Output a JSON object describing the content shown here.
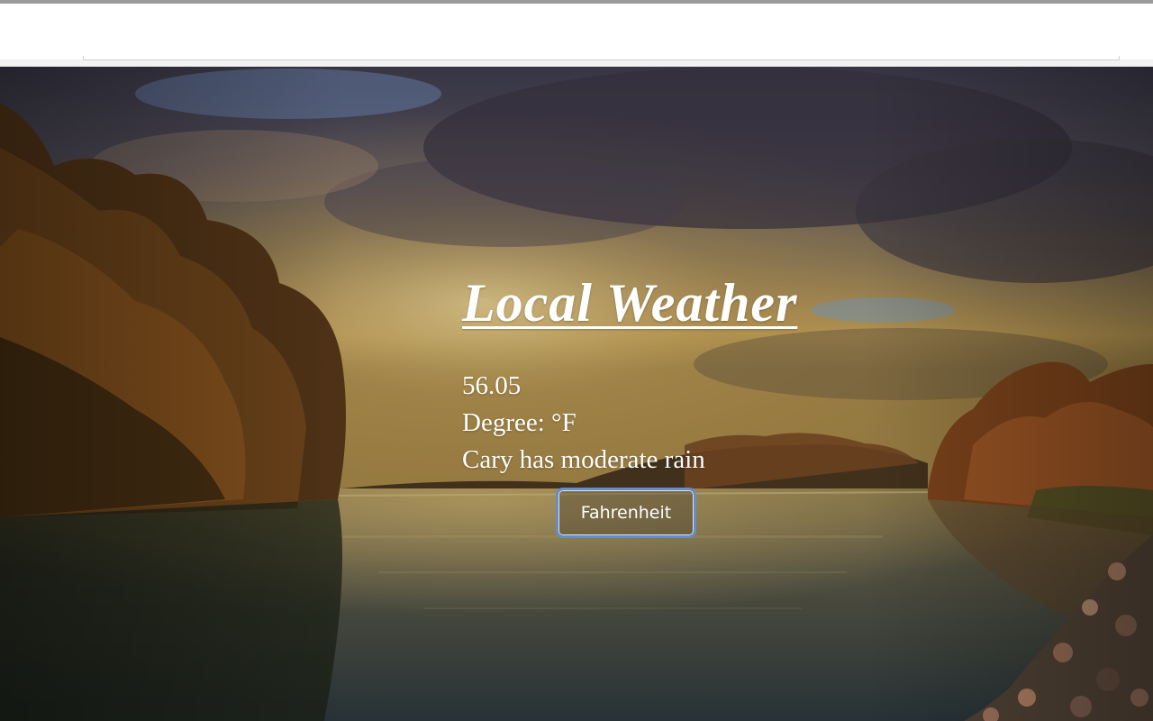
{
  "page": {
    "title": "Local Weather"
  },
  "weather": {
    "temperature": "56.05",
    "degree_label": "Degree: °F",
    "description": "Cary has moderate rain"
  },
  "controls": {
    "unit_button_label": "Fahrenheit"
  },
  "colors": {
    "text": "#ffffff",
    "button_focus_ring": "#5f8fd0",
    "browser_top_strip": "#9a9a9a"
  }
}
